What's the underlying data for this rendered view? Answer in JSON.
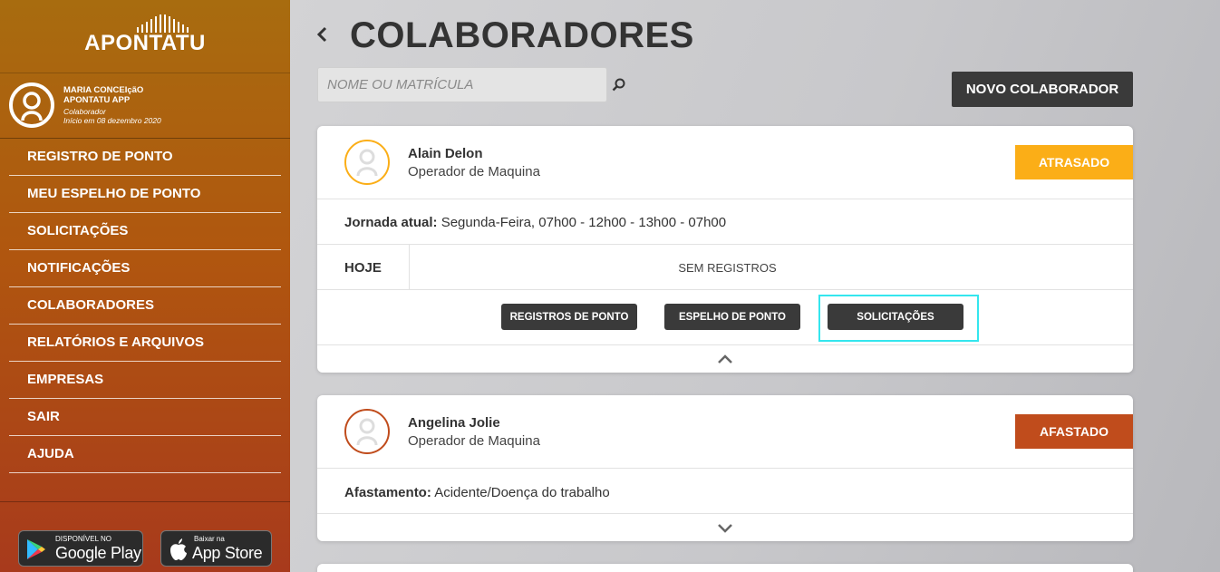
{
  "brand": {
    "logo_text": "APONTATU"
  },
  "user": {
    "name_line1": "MARIA CONCEIçãO",
    "name_line2": "APONTATU APP",
    "role": "Colaborador",
    "since": "Início em 08 dezembro 2020"
  },
  "sidebar": {
    "items": [
      {
        "label": "REGISTRO DE PONTO"
      },
      {
        "label": "MEU ESPELHO DE PONTO"
      },
      {
        "label": "SOLICITAÇÕES"
      },
      {
        "label": "NOTIFICAÇÕES"
      },
      {
        "label": "COLABORADORES"
      },
      {
        "label": "RELATÓRIOS E ARQUIVOS"
      },
      {
        "label": "EMPRESAS"
      },
      {
        "label": "SAIR"
      },
      {
        "label": "AJUDA"
      }
    ]
  },
  "stores": {
    "google_small": "DISPONÍVEL NO",
    "google_big": "Google Play",
    "apple_small": "Baixar na",
    "apple_big": "App Store"
  },
  "header": {
    "title": "COLABORADORES",
    "back_icon": "chevron-left-icon"
  },
  "search": {
    "placeholder": "NOME OU MATRÍCULA",
    "value": ""
  },
  "new_button": {
    "label": "NOVO COLABORADOR"
  },
  "colors": {
    "atrasado": "#fbae17",
    "afastado": "#c04c1c",
    "highlight": "#34e6ee",
    "button_dark": "#3a3a3a"
  },
  "employees": [
    {
      "name": "Alain Delon",
      "role": "Operador de Maquina",
      "status": "ATRASADO",
      "detail_label": "Jornada atual:",
      "detail_value": "Segunda-Feira, 07h00 - 12h00  -  13h00 - 07h00",
      "today_label": "HOJE",
      "today_value": "SEM REGISTROS",
      "actions": [
        "REGISTROS DE PONTO",
        "ESPELHO DE PONTO",
        "SOLICITAÇÕES"
      ],
      "expanded": true
    },
    {
      "name": "Angelina Jolie",
      "role": "Operador de Maquina",
      "status": "AFASTADO",
      "detail_label": "Afastamento:",
      "detail_value": "Acidente/Doença do trabalho",
      "expanded": false
    }
  ]
}
